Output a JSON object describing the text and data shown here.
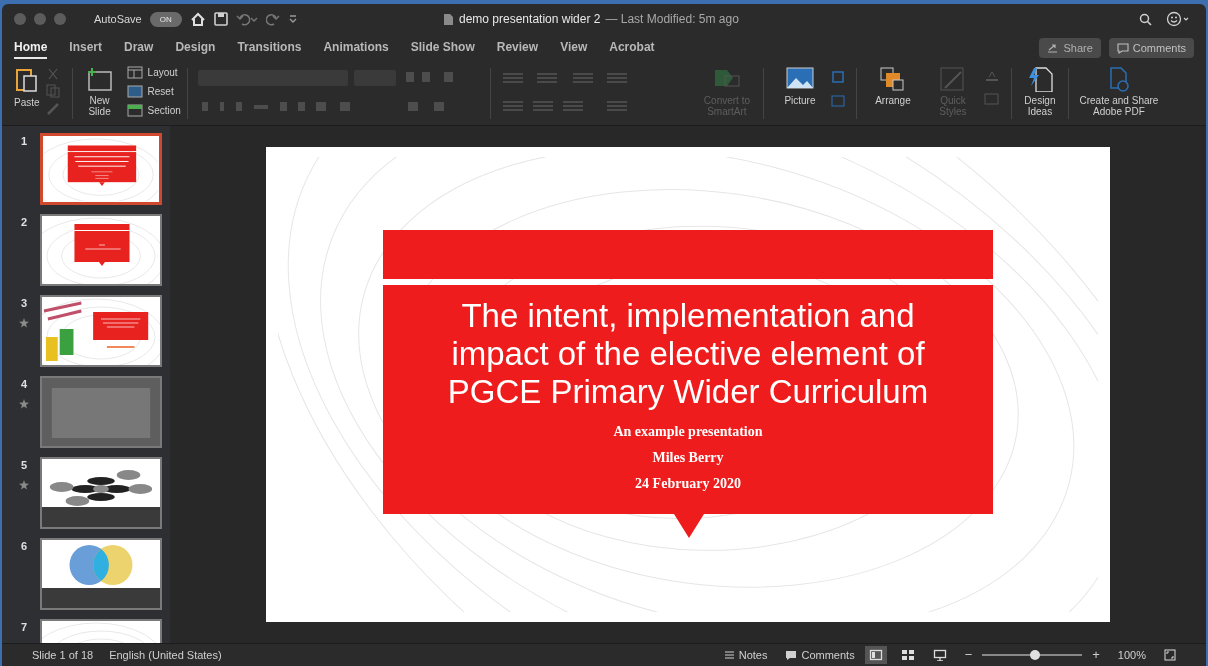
{
  "window": {
    "autosave_label": "AutoSave",
    "autosave_toggle": "ON",
    "title": "demo presentation wider 2",
    "modified": "— Last Modified: 5m ago"
  },
  "tabs": [
    {
      "label": "Home",
      "selected": true
    },
    {
      "label": "Insert",
      "selected": false
    },
    {
      "label": "Draw",
      "selected": false
    },
    {
      "label": "Design",
      "selected": false
    },
    {
      "label": "Transitions",
      "selected": false
    },
    {
      "label": "Animations",
      "selected": false
    },
    {
      "label": "Slide Show",
      "selected": false
    },
    {
      "label": "Review",
      "selected": false
    },
    {
      "label": "View",
      "selected": false
    },
    {
      "label": "Acrobat",
      "selected": false
    }
  ],
  "share_button": "Share",
  "comments_button": "Comments",
  "ribbon": {
    "paste": "Paste",
    "new_slide": "New Slide",
    "slide_options": [
      {
        "kind": "layout",
        "label": "Layout"
      },
      {
        "kind": "reset",
        "label": "Reset"
      },
      {
        "kind": "section",
        "label": "Section"
      }
    ],
    "large_buttons": [
      {
        "kind": "smartart",
        "label": "Convert to SmartArt",
        "disabled": true
      },
      {
        "kind": "picture",
        "label": "Picture",
        "disabled": false
      },
      {
        "kind": "arrange",
        "label": "Arrange",
        "disabled": false
      },
      {
        "kind": "styles",
        "label": "Quick Styles",
        "disabled": true
      },
      {
        "kind": "ideas",
        "label": "Design Ideas",
        "disabled": false
      },
      {
        "kind": "pdf",
        "label": "Create and Share Adobe PDF",
        "disabled": false
      }
    ]
  },
  "thumbnails": [
    {
      "number": "1",
      "kind": "title",
      "selected": true,
      "starred": false
    },
    {
      "number": "2",
      "kind": "textbox",
      "selected": false,
      "starred": false
    },
    {
      "number": "3",
      "kind": "image",
      "selected": false,
      "starred": true
    },
    {
      "number": "4",
      "kind": "photo",
      "selected": false,
      "starred": true
    },
    {
      "number": "5",
      "kind": "diagram",
      "selected": false,
      "starred": true
    },
    {
      "number": "6",
      "kind": "venn",
      "selected": false,
      "starred": false
    },
    {
      "number": "7",
      "kind": "partial",
      "selected": false,
      "starred": false
    }
  ],
  "slide": {
    "title": "The intent, implementation and impact of the elective element of PGCE Primary Wider Curriculum",
    "subtitles": [
      "An example presentation",
      "Miles Berry",
      "24 February 2020"
    ]
  },
  "status_bar": {
    "slide_info": "Slide 1 of 18",
    "language": "English (United States)",
    "notes": "Notes",
    "comments": "Comments",
    "views": [
      {
        "kind": "normal",
        "selected": true
      },
      {
        "kind": "sorter",
        "selected": false
      },
      {
        "kind": "reading",
        "selected": false
      }
    ],
    "zoom_out": "−",
    "zoom_in": "+",
    "zoom": {
      "level": 0.53
    },
    "zoom_label": "100%"
  }
}
